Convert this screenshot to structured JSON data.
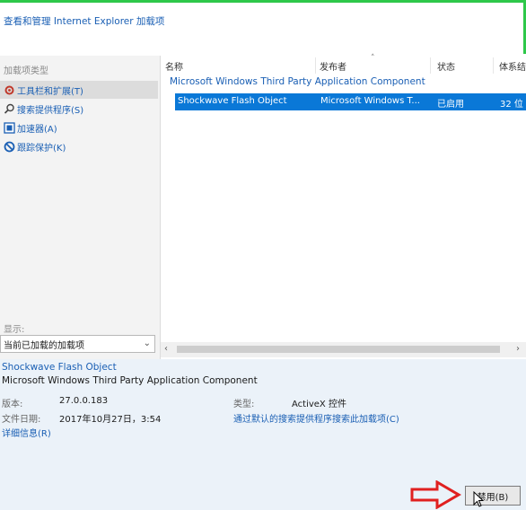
{
  "window": {
    "title": "查看和管理 Internet Explorer 加载项"
  },
  "sidebar": {
    "section_label": "加载项类型",
    "items": [
      {
        "label": "工具栏和扩展(T)",
        "icon": "gear-icon",
        "selected": true
      },
      {
        "label": "搜索提供程序(S)",
        "icon": "search-icon"
      },
      {
        "label": "加速器(A)",
        "icon": "accelerator-icon"
      },
      {
        "label": "跟踪保护(K)",
        "icon": "block-icon"
      }
    ],
    "show_label": "显示:",
    "show_dropdown": {
      "value": "当前已加载的加载项"
    }
  },
  "list": {
    "columns": [
      "名称",
      "发布者",
      "状态",
      "体系结"
    ],
    "group": "Microsoft Windows Third Party Application Component",
    "rows": [
      {
        "name": "Shockwave Flash Object",
        "publisher": "Microsoft Windows T...",
        "status": "已启用",
        "arch": "32 位"
      }
    ]
  },
  "details": {
    "name": "Shockwave Flash Object",
    "publisher": "Microsoft Windows Third Party Application Component",
    "version_label": "版本:",
    "version": "27.0.0.183",
    "date_label": "文件日期:",
    "date": "2017年10月27日，3:54",
    "more_info": "详细信息(R)",
    "type_label": "类型:",
    "type": "ActiveX 控件",
    "search_link": "通过默认的搜索提供程序搜索此加载项(C)"
  },
  "buttons": {
    "disable": "禁用(B)"
  },
  "colors": {
    "accent": "#0a78d7",
    "frame": "#2ec84a",
    "annotation": "#e02020"
  }
}
